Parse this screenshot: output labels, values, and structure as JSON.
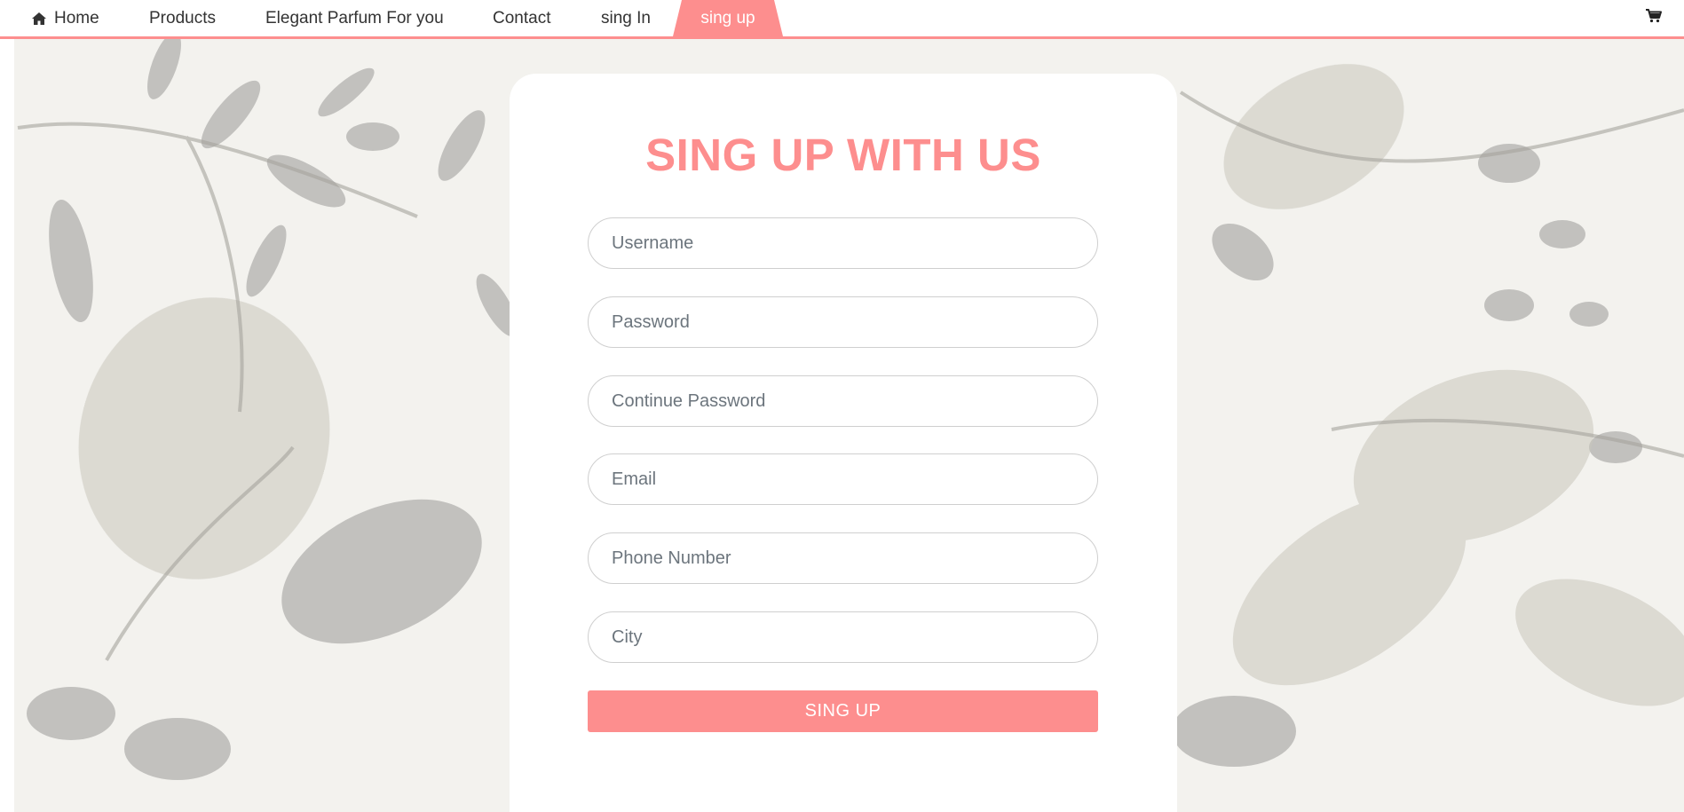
{
  "nav": {
    "items": [
      {
        "label": "Home",
        "icon": "home-icon"
      },
      {
        "label": "Products"
      },
      {
        "label": "Elegant Parfum For you"
      },
      {
        "label": "Contact"
      },
      {
        "label": "sing In"
      },
      {
        "label": "sing up",
        "active": true
      }
    ],
    "cart_icon": "cart-icon"
  },
  "form": {
    "title": "SING UP WITH US",
    "fields": {
      "username": "Username",
      "password": "Password",
      "continue_password": "Continue Password",
      "email": "Email",
      "phone": "Phone Number",
      "city": "City"
    },
    "submit_label": "SING UP"
  },
  "colors": {
    "accent": "#fd8e8e",
    "nav_text": "#333333",
    "placeholder": "#6c757d"
  }
}
